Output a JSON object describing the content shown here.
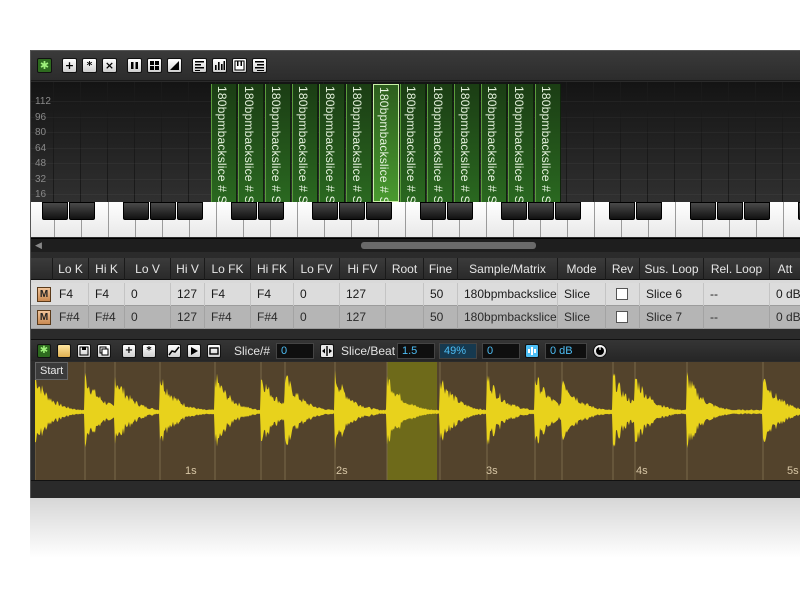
{
  "toolbar": {
    "buttons": [
      {
        "name": "settings-gear-button",
        "glyph": "✱"
      },
      {
        "name": "add-zone-button",
        "glyph": "+"
      },
      {
        "name": "star-button",
        "glyph": "*"
      },
      {
        "name": "delete-button",
        "glyph": "×"
      }
    ]
  },
  "keymap": {
    "velocity_labels": [
      "112",
      "96",
      "80",
      "64",
      "48",
      "32",
      "16"
    ],
    "zone_label": "180bpmbackslice # Slice",
    "zone_count": 13,
    "selected_zone_index": 6
  },
  "table": {
    "headers": [
      "Lo K",
      "Hi K",
      "Lo V",
      "Hi V",
      "Lo FK",
      "Hi FK",
      "Lo FV",
      "Hi FV",
      "Root",
      "Fine",
      "Sample/Matrix",
      "Mode",
      "Rev",
      "Sus. Loop",
      "Rel. Loop",
      "Att"
    ],
    "rows": [
      {
        "badge": "M",
        "lo_k": "F4",
        "hi_k": "F4",
        "lo_v": "0",
        "hi_v": "127",
        "lo_fk": "F4",
        "hi_fk": "F4",
        "lo_fv": "0",
        "hi_fv": "127",
        "root": "",
        "fine": "50",
        "sample": "180bpmbackslice",
        "mode": "Slice",
        "sus_loop": "Slice 6",
        "rel_loop": "--",
        "att": "0 dB"
      },
      {
        "badge": "M",
        "lo_k": "F#4",
        "hi_k": "F#4",
        "lo_v": "0",
        "hi_v": "127",
        "lo_fk": "F#4",
        "hi_fk": "F#4",
        "lo_fv": "0",
        "hi_fv": "127",
        "root": "",
        "fine": "50",
        "sample": "180bpmbackslice",
        "mode": "Slice",
        "sus_loop": "Slice 7",
        "rel_loop": "--",
        "att": "0 dB"
      }
    ]
  },
  "slicebar": {
    "slice_num_label": "Slice/#",
    "slice_num_value": "0",
    "slice_beat_label": "Slice/Beat",
    "slice_beat_value": "1.5",
    "percent_value": "49%",
    "offset_value": "0",
    "gain_value": "0 dB"
  },
  "waveform": {
    "start_label": "Start",
    "time_labels": [
      "1s",
      "2s",
      "3s",
      "4s",
      "5s"
    ],
    "wave_color": "#e8d21c",
    "bg_color": "#53432c",
    "selected_color": "#6e6a1a"
  },
  "colors": {
    "zone_green": "#2a6820",
    "field_text": "#4dbef5"
  }
}
